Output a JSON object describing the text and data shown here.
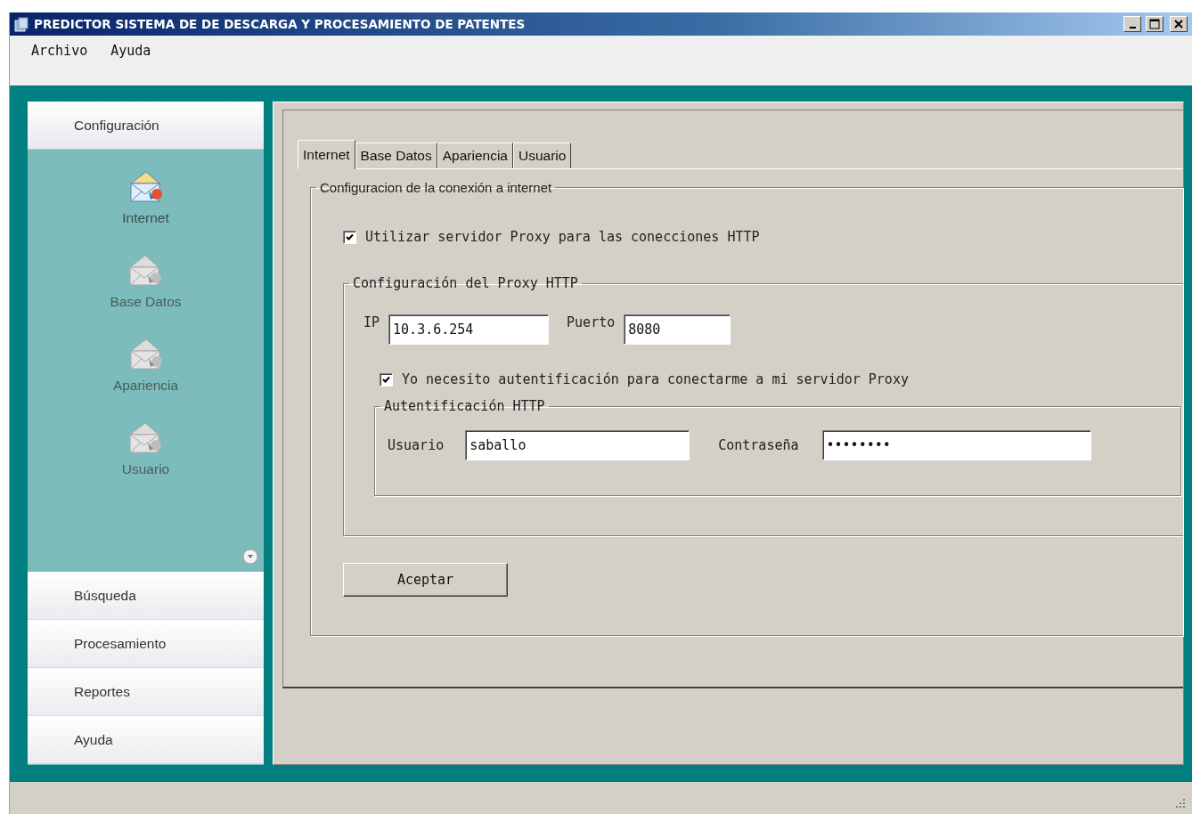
{
  "window": {
    "title": "PREDICTOR SISTEMA DE DE DESCARGA Y PROCESAMIENTO DE PATENTES"
  },
  "menu": [
    "Archivo",
    "Ayuda"
  ],
  "sidebar": {
    "sections": [
      {
        "label": "Configuración",
        "expanded": true,
        "items": [
          {
            "label": "Internet",
            "selected": true
          },
          {
            "label": "Base Datos",
            "selected": false
          },
          {
            "label": "Apariencia",
            "selected": false
          },
          {
            "label": "Usuario",
            "selected": false
          }
        ]
      },
      {
        "label": "Búsqueda",
        "expanded": false
      },
      {
        "label": "Procesamiento",
        "expanded": false
      },
      {
        "label": "Reportes",
        "expanded": false
      },
      {
        "label": "Ayuda",
        "expanded": false
      }
    ]
  },
  "tabs": [
    {
      "label": "Internet",
      "selected": true
    },
    {
      "label": "Base Datos",
      "selected": false
    },
    {
      "label": "Apariencia",
      "selected": false
    },
    {
      "label": "Usuario",
      "selected": false
    }
  ],
  "connection_group": {
    "title": "Configuracion de la conexión a internet",
    "use_proxy": {
      "label": "Utilizar servidor Proxy para las conecciones HTTP",
      "checked": true
    },
    "proxy_group": {
      "title": "Configuración del Proxy HTTP",
      "ip": {
        "label": "IP",
        "value": "10.3.6.254"
      },
      "port": {
        "label": "Puerto",
        "value": "8080"
      },
      "needs_auth": {
        "label": "Yo necesito autentificación  para conectarme a mi servidor Proxy",
        "checked": true
      },
      "auth_group": {
        "title": "Autentificación HTTP",
        "user": {
          "label": "Usuario",
          "value": "saballo"
        },
        "password": {
          "label": "Contraseña",
          "value": "••••••••"
        }
      }
    }
  },
  "accept_button": "Aceptar"
}
